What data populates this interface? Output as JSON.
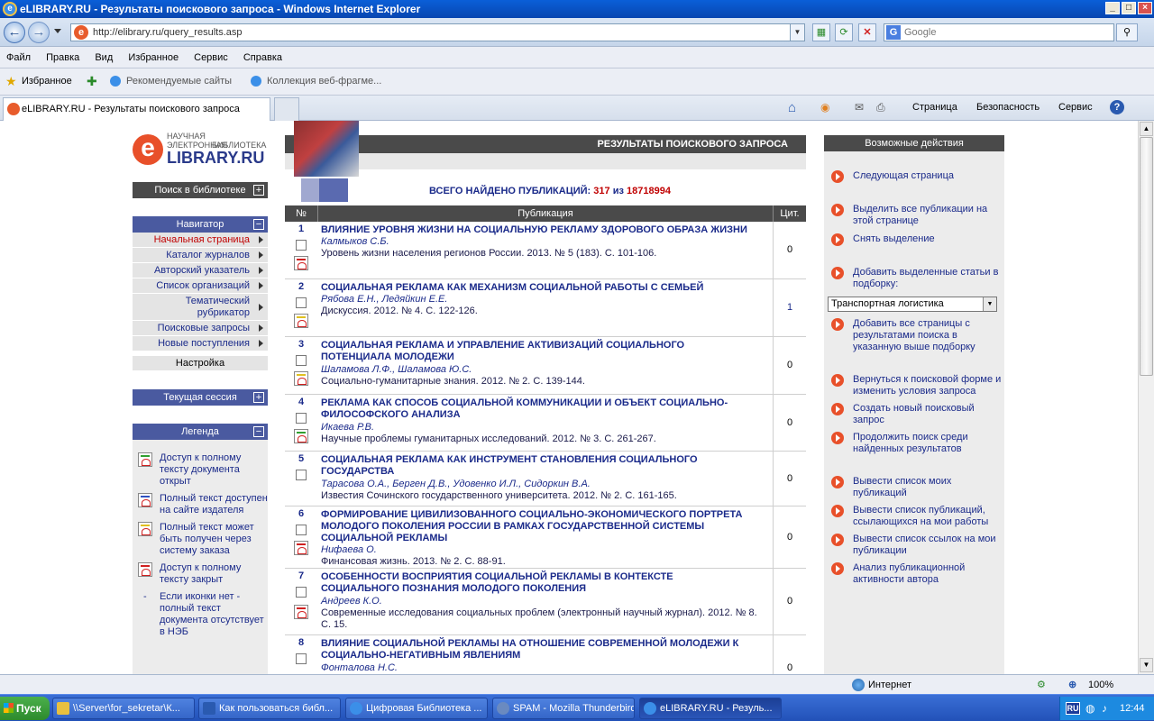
{
  "window": {
    "title": "eLIBRARY.RU - Результаты поискового запроса - Windows Internet Explorer"
  },
  "address": {
    "url": "http://elibrary.ru/query_results.asp",
    "search_placeholder": "Google"
  },
  "menu": [
    "Файл",
    "Правка",
    "Вид",
    "Избранное",
    "Сервис",
    "Справка"
  ],
  "favbar": {
    "favorites": "Избранное",
    "recommended": "Рекомендуемые сайты",
    "gallery": "Коллекция веб-фрагме..."
  },
  "tab": {
    "title": "eLIBRARY.RU - Результаты поискового запроса"
  },
  "cmdbar": {
    "page": "Страница",
    "security": "Безопасность",
    "service": "Сервис"
  },
  "logo": {
    "line1": "НАУЧНАЯ ЭЛЕКТРОННАЯ",
    "line2": "БИБЛИОТЕКА",
    "brand": "LIBRARY.RU",
    "e": "e"
  },
  "left": {
    "search": "Поиск в библиотеке",
    "navigator": "Навигатор",
    "nav_items": [
      "Начальная страница",
      "Каталог журналов",
      "Авторский указатель",
      "Список организаций",
      "Тематический рубрикатор",
      "Поисковые запросы",
      "Новые поступления"
    ],
    "settings": "Настройка",
    "session": "Текущая сессия",
    "legend": "Легенда",
    "legend_items": [
      "Доступ к полному тексту документа открыт",
      "Полный текст доступен на сайте издателя",
      "Полный текст может быть получен через систему заказа",
      "Доступ к полному тексту закрыт",
      "Если иконки нет - полный текст документа отсутствует в НЭБ"
    ],
    "legend_dash": "-"
  },
  "main": {
    "header": "РЕЗУЛЬТАТЫ ПОИСКОВОГО ЗАПРОСА",
    "found_label": "ВСЕГО НАЙДЕНО ПУБЛИКАЦИЙ:",
    "found": "317",
    "of": "из",
    "total": "18718994",
    "col_num": "№",
    "col_pub": "Публикация",
    "col_cit": "Цит.",
    "rows": [
      {
        "n": "1",
        "title": "ВЛИЯНИЕ УРОВНЯ ЖИЗНИ НА СОЦИАЛЬНУЮ РЕКЛАМУ ЗДОРОВОГО ОБРАЗА ЖИЗНИ",
        "authors": "Калмыков С.Б.",
        "source": "Уровень жизни населения регионов России. 2013. № 5 (183). С. 101-106.",
        "cit": "0"
      },
      {
        "n": "2",
        "title": "СОЦИАЛЬНАЯ РЕКЛАМА КАК МЕХАНИЗМ СОЦИАЛЬНОЙ РАБОТЫ С СЕМЬЕЙ",
        "authors": "Рябова Е.Н., Ледяйкин Е.Е.",
        "source": "Дискуссия. 2012. № 4. С. 122-126.",
        "cit": "1"
      },
      {
        "n": "3",
        "title": "СОЦИАЛЬНАЯ РЕКЛАМА И УПРАВЛЕНИЕ АКТИВИЗАЦИЙ СОЦИАЛЬНОГО ПОТЕНЦИАЛА МОЛОДЕЖИ",
        "authors": "Шаламова Л.Ф., Шаламова Ю.С.",
        "source": "Социально-гуманитарные знания. 2012. № 2. С. 139-144.",
        "cit": "0"
      },
      {
        "n": "4",
        "title": "РЕКЛАМА КАК СПОСОБ СОЦИАЛЬНОЙ КОММУНИКАЦИИ И ОБЪЕКТ СОЦИАЛЬНО-ФИЛОСОФСКОГО АНАЛИЗА",
        "authors": "Икаева Р.В.",
        "source": "Научные проблемы гуманитарных исследований. 2012. № 3. С. 261-267.",
        "cit": "0"
      },
      {
        "n": "5",
        "title": "СОЦИАЛЬНАЯ РЕКЛАМА КАК ИНСТРУМЕНТ СТАНОВЛЕНИЯ СОЦИАЛЬНОГО ГОСУДАРСТВА",
        "authors": "Тарасова О.А., Берген Д.В., Удовенко И.Л., Сидоркин В.А.",
        "source": "Известия Сочинского государственного университета. 2012. № 2. С. 161-165.",
        "cit": "0"
      },
      {
        "n": "6",
        "title": "ФОРМИРОВАНИЕ ЦИВИЛИЗОВАННОГО СОЦИАЛЬНО-ЭКОНОМИЧЕСКОГО ПОРТРЕТА МОЛОДОГО ПОКОЛЕНИЯ РОССИИ В РАМКАХ ГОСУДАРСТВЕННОЙ СИСТЕМЫ СОЦИАЛЬНОЙ РЕКЛАМЫ",
        "authors": "Нифаева О.",
        "source": "Финансовая жизнь. 2013. № 2. С. 88-91.",
        "cit": "0"
      },
      {
        "n": "7",
        "title": "ОСОБЕННОСТИ ВОСПРИЯТИЯ СОЦИАЛЬНОЙ РЕКЛАМЫ В КОНТЕКСТЕ СОЦИАЛЬНОГО ПОЗНАНИЯ МОЛОДОГО ПОКОЛЕНИЯ",
        "authors": "Андреев К.О.",
        "source": "Современные исследования социальных проблем (электронный научный журнал). 2012. № 8. С. 15.",
        "cit": "0"
      },
      {
        "n": "8",
        "title": "ВЛИЯНИЕ СОЦИАЛЬНОЙ РЕКЛАМЫ НА ОТНОШЕНИЕ СОВРЕМЕННОЙ МОЛОДЕЖИ К СОЦИАЛЬНО-НЕГАТИВНЫМ ЯВЛЕНИЯМ",
        "authors": "Фонталова Н.С.",
        "source": "",
        "cit": "0"
      }
    ]
  },
  "right": {
    "header": "Возможные действия",
    "actions": [
      "Следующая страница",
      "Выделить все публикации на этой странице",
      "Снять выделение",
      "Добавить выделенные статьи в подборку:",
      "Добавить все страницы с результатами поиска в указанную выше подборку",
      "Вернуться к поисковой форме и изменить условия запроса",
      "Создать новый поисковый запрос",
      "Продолжить поиск среди найденных результатов",
      "Вывести список моих публикаций",
      "Вывести список публикаций, ссылающихся на мои работы",
      "Вывести список ссылок на мои публикации",
      "Анализ публикационной активности автора"
    ],
    "select_value": "Транспортная логистика"
  },
  "status": {
    "zone": "Интернет",
    "zoom": "100%"
  },
  "taskbar": {
    "start": "Пуск",
    "items": [
      "\\\\Server\\for_sekretar\\К...",
      "Как пользоваться библ...",
      "Цифровая Библиотека ...",
      "SPAM - Mozilla Thunderbird",
      "eLIBRARY.RU - Резуль..."
    ],
    "lang": "RU",
    "time": "12:44"
  },
  "colors": {
    "accent": "#e8502a",
    "link": "#1a2a8a",
    "red": "#c00000",
    "header": "#4a4a4a"
  }
}
